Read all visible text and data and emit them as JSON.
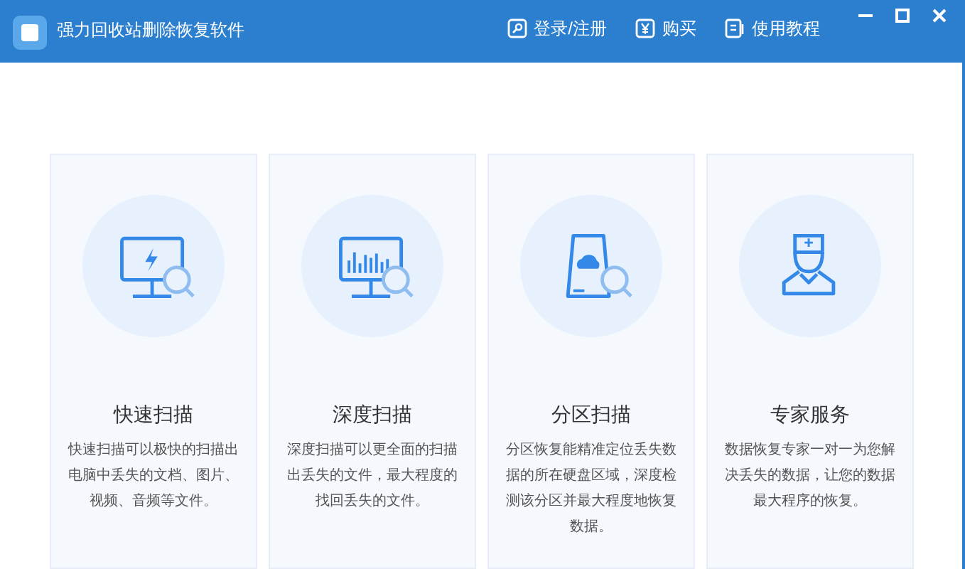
{
  "window": {
    "title": "强力回收站删除恢复软件"
  },
  "header_links": [
    {
      "kind": "login",
      "label": "登录/注册"
    },
    {
      "kind": "buy",
      "label": "购买"
    },
    {
      "kind": "tutorial",
      "label": "使用教程"
    }
  ],
  "cards": [
    {
      "kind": "quick",
      "title": "快速扫描",
      "description": "快速扫描可以极快的扫描出电脑中丢失的文档、图片、视频、音频等文件。"
    },
    {
      "kind": "deep",
      "title": "深度扫描",
      "description": "深度扫描可以更全面的扫描出丢失的文件，最大程度的找回丢失的文件。"
    },
    {
      "kind": "partition",
      "title": "分区扫描",
      "description": "分区恢复能精准定位丢失数据的所在硬盘区域，深度检测该分区并最大程度地恢复数据。"
    },
    {
      "kind": "expert",
      "title": "专家服务",
      "description": "数据恢复专家一对一为您解决丢失的数据，让您的数据最大程序的恢复。"
    }
  ]
}
